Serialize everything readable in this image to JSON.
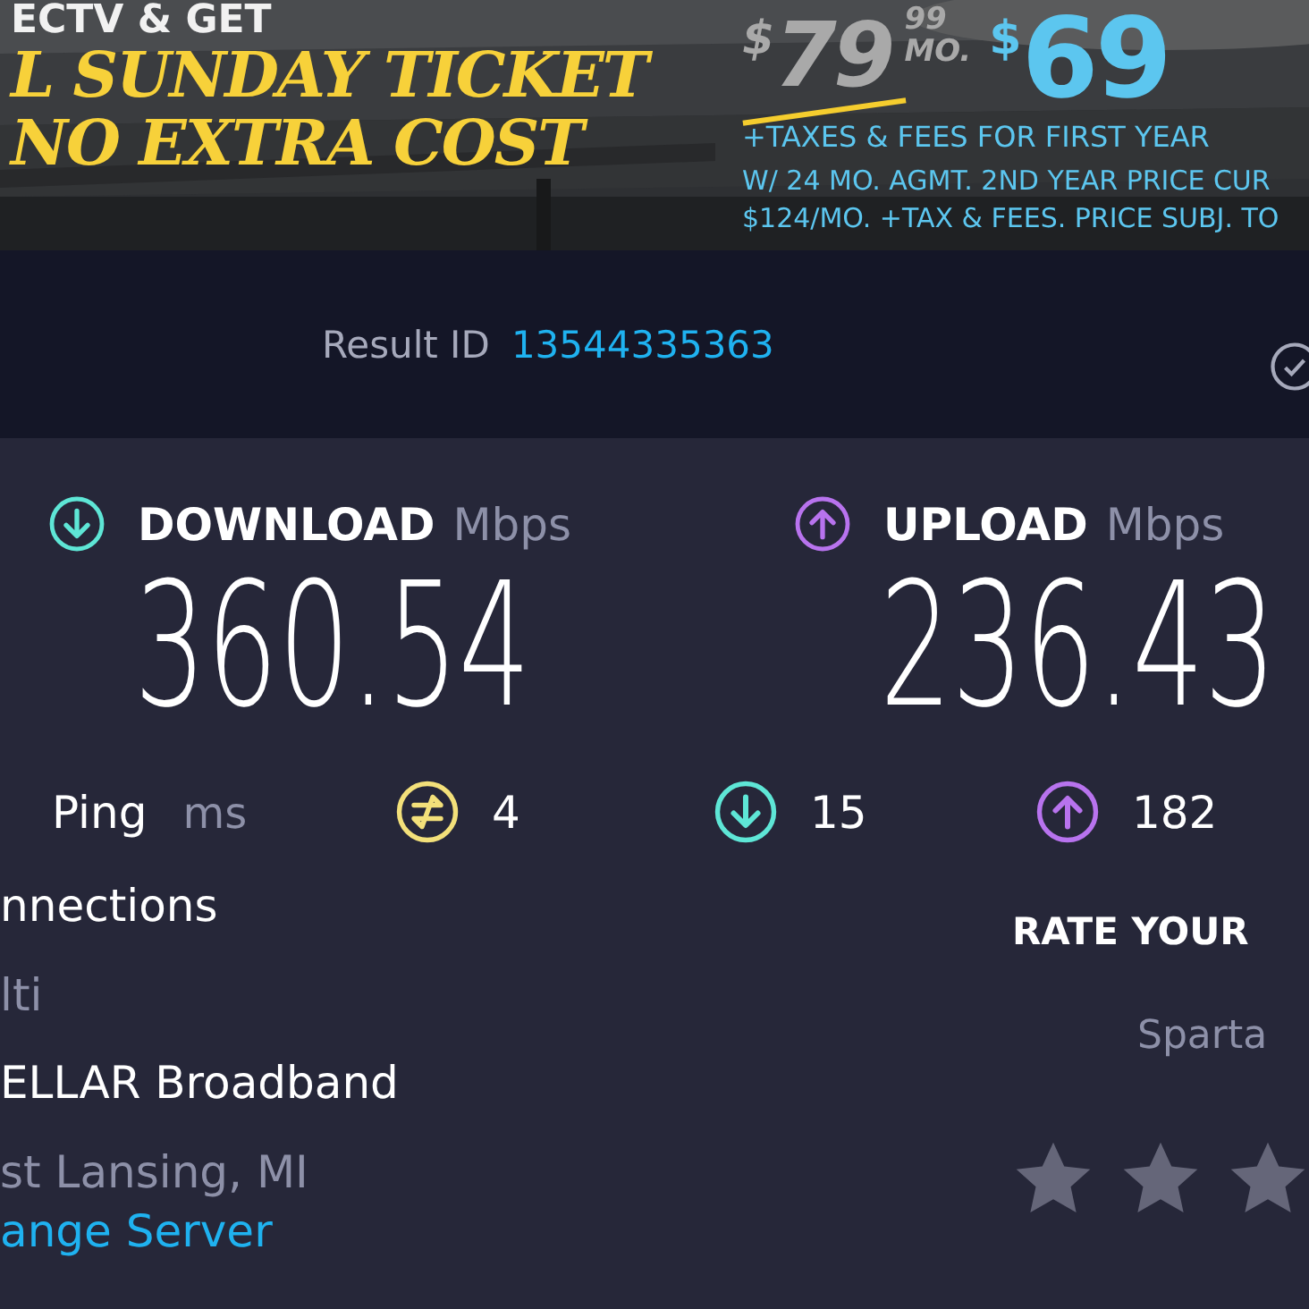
{
  "ad": {
    "kind": "picture",
    "headline": [
      "ECTV & GET",
      "L SUNDAY TICKET",
      "NO EXTRA COST"
    ],
    "old_price": {
      "dollar": "$",
      "amount": "79",
      "cents": "99",
      "per": "MO."
    },
    "new_price": {
      "dollar": "$",
      "amount": "69"
    },
    "fine_print": [
      "+TAXES & FEES FOR FIRST YEAR",
      "W/ 24 MO. AGMT. 2ND YEAR PRICE CUR",
      "$124/MO. +TAX & FEES. PRICE SUBJ. TO"
    ]
  },
  "result": {
    "label": "Result ID",
    "id": "13544335363"
  },
  "speeds": [
    {
      "kind": "download",
      "label": "DOWNLOAD",
      "unit": "Mbps",
      "value": "360.54"
    },
    {
      "kind": "upload",
      "label": "UPLOAD",
      "unit": "Mbps",
      "value": "236.43"
    }
  ],
  "ping": {
    "label": "Ping",
    "unit": "ms",
    "items": [
      {
        "kind": "jitter",
        "value": "4"
      },
      {
        "kind": "download",
        "value": "15"
      },
      {
        "kind": "upload",
        "value": "182"
      }
    ]
  },
  "details": [
    {
      "title": "nnections",
      "subtitle": "lti"
    },
    {
      "title": "ELLAR Broadband",
      "subtitle": "st Lansing, MI"
    }
  ],
  "change_server": "ange Server",
  "rating": {
    "title": "RATE YOUR",
    "provider": "Sparta",
    "stars": 0
  }
}
